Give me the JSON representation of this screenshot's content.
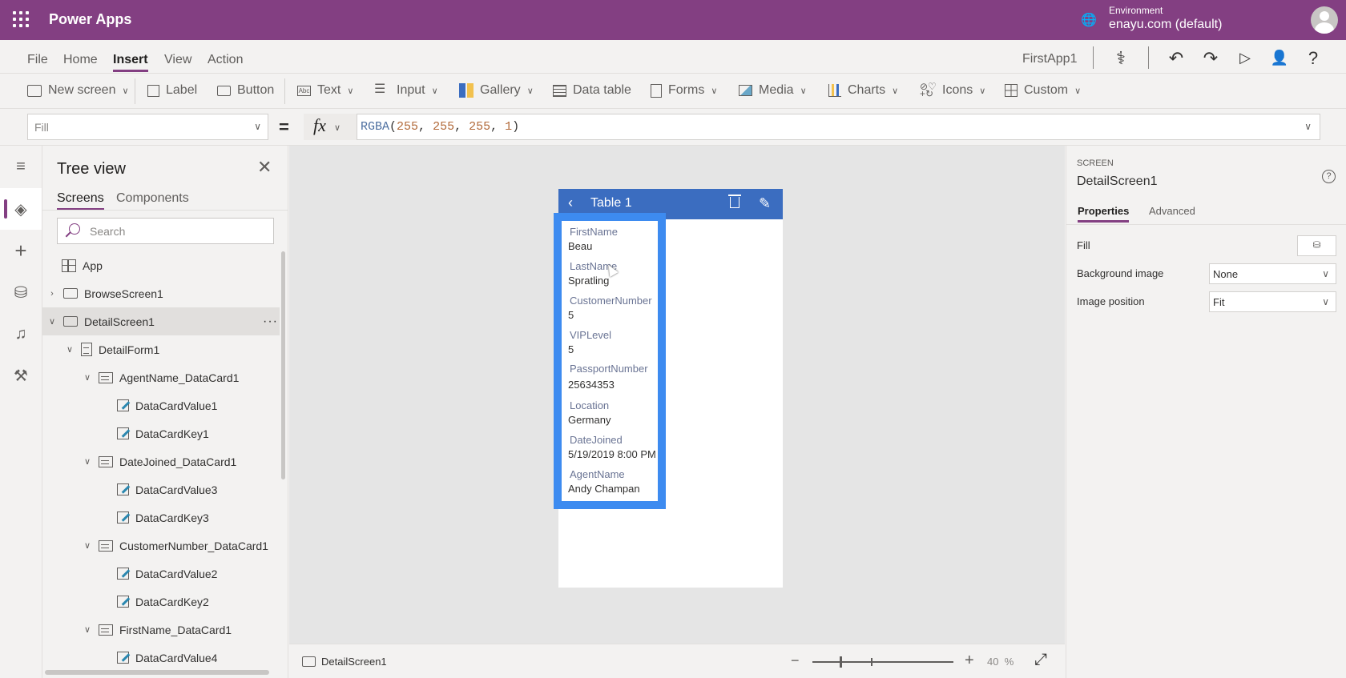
{
  "topbar": {
    "app_name": "Power Apps",
    "environment_label": "Environment",
    "environment_value": "enayu.com (default)"
  },
  "menubar": {
    "items": [
      "File",
      "Home",
      "Insert",
      "View",
      "Action"
    ],
    "active": "Insert",
    "app_title": "FirstApp1"
  },
  "ribbon": {
    "new_screen": "New screen",
    "label": "Label",
    "button": "Button",
    "text": "Text",
    "input": "Input",
    "gallery": "Gallery",
    "data_table": "Data table",
    "forms": "Forms",
    "media": "Media",
    "charts": "Charts",
    "icons": "Icons",
    "custom": "Custom"
  },
  "formula": {
    "property": "Fill",
    "equals": "=",
    "fx": "fx",
    "function": "RGBA",
    "args": [
      "255",
      "255",
      "255",
      "1"
    ]
  },
  "treeview": {
    "title": "Tree view",
    "tabs": [
      "Screens",
      "Components"
    ],
    "search_placeholder": "Search",
    "items": [
      {
        "label": "App",
        "type": "app"
      },
      {
        "label": "BrowseScreen1",
        "type": "screen"
      },
      {
        "label": "DetailScreen1",
        "type": "screen"
      },
      {
        "label": "DetailForm1",
        "type": "form"
      },
      {
        "label": "AgentName_DataCard1",
        "type": "card"
      },
      {
        "label": "DataCardValue1",
        "type": "edit"
      },
      {
        "label": "DataCardKey1",
        "type": "edit"
      },
      {
        "label": "DateJoined_DataCard1",
        "type": "card"
      },
      {
        "label": "DataCardValue3",
        "type": "edit"
      },
      {
        "label": "DataCardKey3",
        "type": "edit"
      },
      {
        "label": "CustomerNumber_DataCard1",
        "type": "card"
      },
      {
        "label": "DataCardValue2",
        "type": "edit"
      },
      {
        "label": "DataCardKey2",
        "type": "edit"
      },
      {
        "label": "FirstName_DataCard1",
        "type": "card"
      },
      {
        "label": "DataCardValue4",
        "type": "edit"
      }
    ],
    "more": "···"
  },
  "canvas": {
    "header_title": "Table 1",
    "fields": [
      {
        "label": "FirstName",
        "value": "Beau"
      },
      {
        "label": "LastName",
        "value": "Spratling"
      },
      {
        "label": "CustomerNumber",
        "value": "5"
      },
      {
        "label": "VIPLevel",
        "value": "5"
      },
      {
        "label": "PassportNumber",
        "value": "25634353"
      },
      {
        "label": "Location",
        "value": "Germany"
      },
      {
        "label": "DateJoined",
        "value": "5/19/2019 8:00 PM"
      },
      {
        "label": "AgentName",
        "value": "Andy Champan"
      }
    ]
  },
  "statusbar": {
    "screen_name": "DetailScreen1",
    "zoom_value": "40",
    "zoom_unit": "%"
  },
  "properties": {
    "kind": "SCREEN",
    "name": "DetailScreen1",
    "tabs": [
      "Properties",
      "Advanced"
    ],
    "fill_label": "Fill",
    "background_image_label": "Background image",
    "background_image_value": "None",
    "image_position_label": "Image position",
    "image_position_value": "Fit"
  },
  "colors": {
    "brand": "#833f82",
    "canvas_header": "#3b6dc0",
    "selection": "#3d8bf0"
  }
}
